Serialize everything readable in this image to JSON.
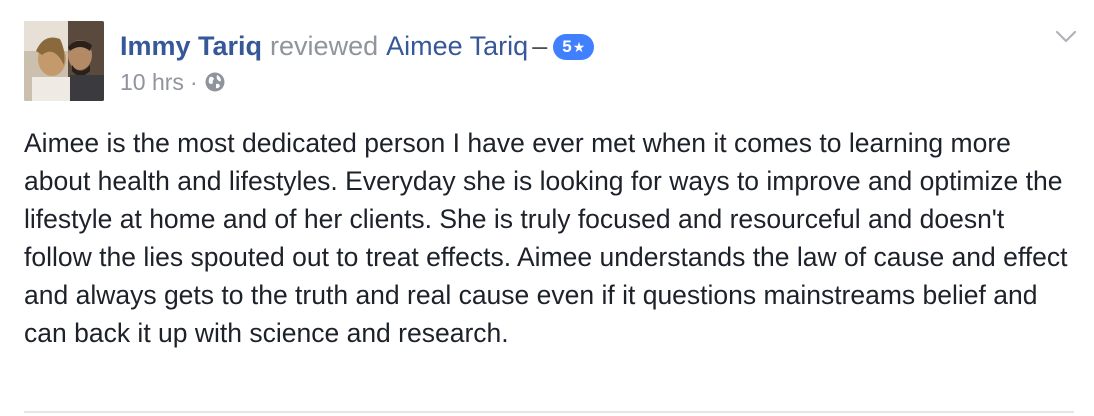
{
  "review": {
    "author": "Immy Tariq",
    "verb": "reviewed",
    "target": "Aimee Tariq",
    "dash": "–",
    "rating_value": "5",
    "rating_star": "★",
    "timestamp": "10 hrs",
    "separator": "·",
    "privacy_icon": "globe-icon",
    "avatar_alt": "profile photo",
    "body": "Aimee is the most dedicated person I have ever met when it comes to learning more about health and lifestyles. Everyday she is looking for ways to improve and optimize the lifestyle at home and of her clients. She is truly focused and resourceful and doesn't follow the lies spouted out to treat effects. Aimee understands the law of cause and effect and always gets to the truth and real cause even if it questions mainstreams belief and can back it up with science and research."
  },
  "colors": {
    "link": "#365899",
    "meta": "#90949c",
    "text": "#1d2129",
    "badge": "#4080ff"
  }
}
